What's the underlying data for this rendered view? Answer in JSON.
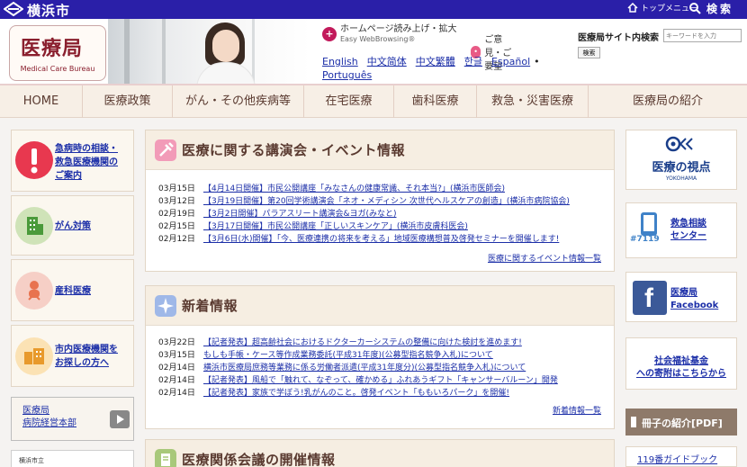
{
  "topbar": {
    "city_name": "横浜市",
    "top_menu": "トップメニュー",
    "search": "検索"
  },
  "header": {
    "logo_title": "医療局",
    "logo_subtitle": "Medical Care Bureau",
    "voice_main": "ホームページ読み上げ・拡大",
    "voice_sub": "Easy WebBrowsing®",
    "opinion": "ご意見・ご要望",
    "languages": [
      "English",
      "中文简体",
      "中文繁體",
      "한글",
      "Español",
      "Português"
    ],
    "site_search_label": "医療局サイト内検索",
    "site_search_placeholder": "キーワードを入力",
    "site_search_button": "検索"
  },
  "nav": [
    {
      "label": "HOME"
    },
    {
      "label": "医療政策"
    },
    {
      "label": "がん・その他疾病等"
    },
    {
      "label": "在宅医療"
    },
    {
      "label": "歯科医療"
    },
    {
      "label": "救急・災害医療"
    },
    {
      "label": "医療局の紹介"
    }
  ],
  "left": {
    "emergency": "急病時の相談・救急医療機関のご案内",
    "emergency_lines": [
      "急病時の相談・",
      "救急医療機関の",
      "ご案内"
    ],
    "cancer": "がん対策",
    "obstetrics": "産科医療",
    "find_lines": [
      "市内医療機関を",
      "お探しの方へ"
    ],
    "hospital_lines": [
      "医療局",
      "病院経営本部"
    ],
    "hospital_small": "横浜市立"
  },
  "events": {
    "title": "医療に関する講演会・イベント情報",
    "items": [
      {
        "date": "03月15日",
        "text": "【4月14日開催】市民公開講座「みなさんの健康常識、それ本当?」(横浜市医師会)"
      },
      {
        "date": "03月12日",
        "text": "【3月19日開催】第20回学術講演会「ネオ・メディシン 次世代ヘルスケアの創造」(横浜市病院協会)"
      },
      {
        "date": "02月19日",
        "text": "【3月2日開催】パラアスリート講演会&ヨガ(みなと)"
      },
      {
        "date": "02月15日",
        "text": "【3月17日開催】市民公開講座「正しいスキンケア」(横浜市皮膚科医会)"
      },
      {
        "date": "02月12日",
        "text": "【3月6日(水)開催】「今、医療連携の将来を考える」地域医療構想普及啓発セミナーを開催します!"
      }
    ],
    "more": "医療に関するイベント情報一覧"
  },
  "news": {
    "title": "新着情報",
    "items": [
      {
        "date": "03月22日",
        "text": "【記者発表】超高齢社会におけるドクターカーシステムの整備に向けた検討を進めます!"
      },
      {
        "date": "03月15日",
        "text": "もしも手帳・ケース等作成業務委託(平成31年度)(公募型指名競争入札)について"
      },
      {
        "date": "02月14日",
        "text": "横浜市医療局庶務等業務に係る労働者派遣(平成31年度分)(公募型指名競争入札)について"
      },
      {
        "date": "02月14日",
        "text": "【記者発表】風船で「触れて、なぞって、確かめる」ふれあうギフト「キャンサーバルーン」開発"
      },
      {
        "date": "02月14日",
        "text": "【記者発表】家族で学ぼう!乳がんのこと。啓発イベント「ももいろパーク」を開催!"
      }
    ],
    "more": "新着情報一覧"
  },
  "meeting": {
    "title": "医療関係会議の開催情報"
  },
  "right": {
    "perspective_main": "医療の視点",
    "perspective_sub": "YOKOHAMA",
    "consult_lines": [
      "救急相談",
      "センター"
    ],
    "phone_badge": "#7119",
    "facebook_lines": [
      "医療局",
      "Facebook"
    ],
    "welfare_lines": [
      "社会福祉基金",
      "への寄附はこちらから"
    ],
    "booklet_title": "冊子の紹介[PDF]",
    "booklet_item": "119番ガイドブック"
  },
  "colors": {
    "topbar": "#2a1fa8",
    "link": "#1c2fa8",
    "brand": "#8a1f2e",
    "nav_bg": "#f7efe6"
  }
}
